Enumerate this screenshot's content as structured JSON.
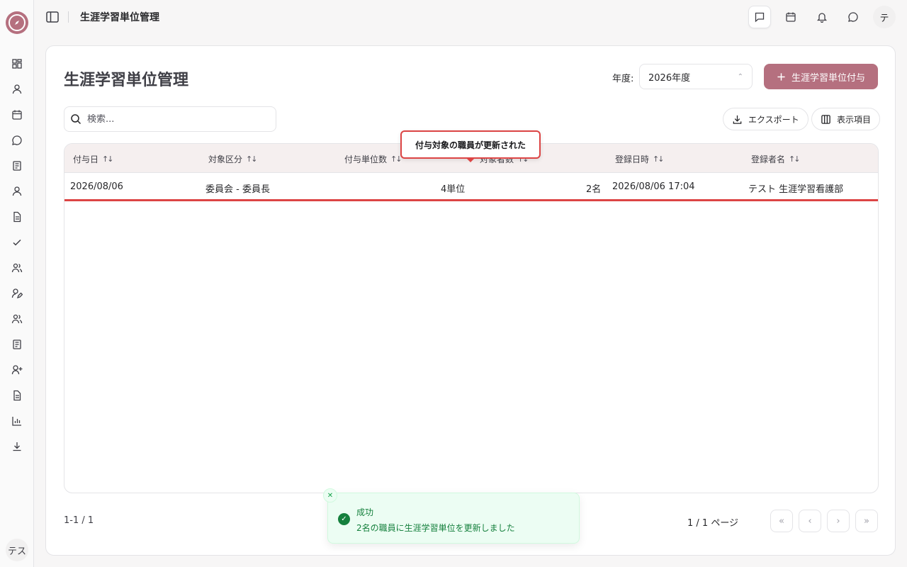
{
  "header": {
    "title": "生涯学習単位管理",
    "avatar": "テ"
  },
  "sidebar": {
    "avatar": "テス",
    "items": [
      {
        "icon": "dashboard-icon"
      },
      {
        "icon": "user-icon"
      },
      {
        "icon": "calendar-icon"
      },
      {
        "icon": "chat-icon"
      },
      {
        "icon": "book-icon"
      },
      {
        "icon": "user-icon"
      },
      {
        "icon": "document-icon"
      },
      {
        "icon": "check-icon"
      },
      {
        "icon": "users-icon"
      },
      {
        "icon": "user-edit-icon"
      },
      {
        "icon": "users-icon"
      },
      {
        "icon": "book-icon"
      },
      {
        "icon": "user-plus-icon"
      },
      {
        "icon": "document-icon"
      },
      {
        "icon": "chart-icon"
      },
      {
        "icon": "download-icon"
      }
    ]
  },
  "main": {
    "title": "生涯学習単位管理",
    "year_label": "年度:",
    "year_value": "2026年度",
    "add_button": "生涯学習単位付与",
    "search_placeholder": "検索...",
    "export_label": "エクスポート",
    "columns_label": "表示項目"
  },
  "table": {
    "columns": [
      "付与日",
      "対象区分",
      "付与単位数",
      "対象者数",
      "登録日時",
      "登録者名"
    ],
    "rows": [
      [
        "2026/08/06",
        "委員会 - 委員長",
        "4単位",
        "2名",
        "2026/08/06 17:04",
        "テスト 生涯学習看護部"
      ]
    ]
  },
  "tooltip": "付与対象の職員が更新された",
  "footer": {
    "range": "1-1 / 1",
    "page_info": "1 / 1 ページ"
  },
  "toast": {
    "title": "成功",
    "message": "2名の職員に生涯学習単位を更新しました"
  },
  "colors": {
    "accent": "#b5707f",
    "highlight": "#dc4444",
    "success": "#15803d"
  }
}
